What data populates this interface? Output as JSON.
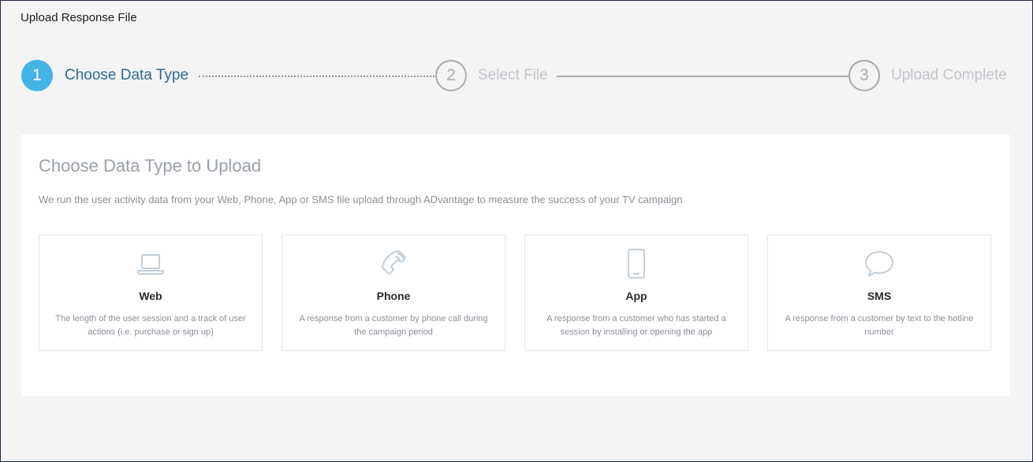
{
  "page": {
    "title": "Upload Response File"
  },
  "stepper": {
    "steps": [
      {
        "number": "1",
        "label": "Choose Data Type",
        "state": "active"
      },
      {
        "number": "2",
        "label": "Select File",
        "state": "inactive"
      },
      {
        "number": "3",
        "label": "Upload Complete",
        "state": "inactive"
      }
    ]
  },
  "panel": {
    "title": "Choose Data Type to Upload",
    "description": "We run the user activity data from your Web, Phone, App or SMS file upload through ADvantage to measure the success of your TV campaign",
    "types": [
      {
        "icon": "laptop-icon",
        "name": "Web",
        "description": "The length of the user session and a track of user actions (i.e. purchase or sign up)"
      },
      {
        "icon": "phone-icon",
        "name": "Phone",
        "description": "A response from a customer by phone call during the campaign period"
      },
      {
        "icon": "mobile-device-icon",
        "name": "App",
        "description": "A response from a customer who has started a session by installing or opening the app"
      },
      {
        "icon": "chat-bubble-icon",
        "name": "SMS",
        "description": "A response from a customer by text to the hotline number"
      }
    ]
  },
  "colors": {
    "accent": "#43b4e5",
    "active_label": "#2e6a91",
    "inactive": "#a6aab2",
    "icon": "#c3ced8"
  }
}
